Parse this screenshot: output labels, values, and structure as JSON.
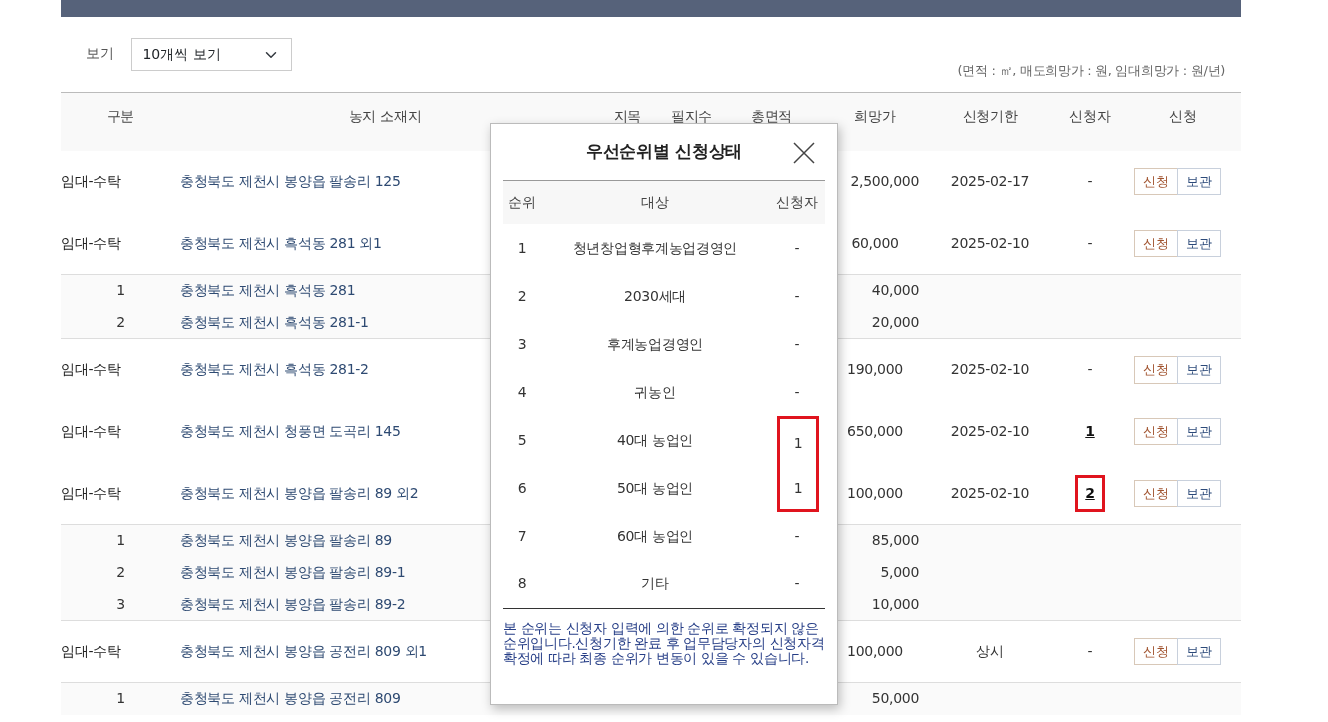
{
  "view_control": {
    "label": "보기",
    "value": "10개씩 보기"
  },
  "unit_note": "(면적 : ㎡, 매도희망가 : 원, 임대희망가 : 원/년)",
  "table": {
    "columns": [
      "구분",
      "농지 소재지",
      "지목",
      "필지수",
      "총면적",
      "희망가",
      "신청기한",
      "신청자",
      "신청"
    ],
    "rows": [
      {
        "type": "임대-수탁",
        "location": "충청북도 제천시 봉양읍 팔송리 125",
        "price": "2,500,000",
        "deadline": "2025-02-17",
        "applicants": "-",
        "applicants_link": false,
        "highlighted": false,
        "actions": [
          "신청",
          "보관"
        ],
        "parcels": []
      },
      {
        "type": "임대-수탁",
        "location": "충청북도 제천시 흑석동 281 외1",
        "price": "60,000",
        "deadline": "2025-02-10",
        "applicants": "-",
        "applicants_link": false,
        "highlighted": false,
        "actions": [
          "신청",
          "보관"
        ],
        "parcels": [
          {
            "index": "1",
            "location": "충청북도 제천시 흑석동 281",
            "price": "40,000"
          },
          {
            "index": "2",
            "location": "충청북도 제천시 흑석동 281-1",
            "price": "20,000"
          }
        ]
      },
      {
        "type": "임대-수탁",
        "location": "충청북도 제천시 흑석동 281-2",
        "price": "190,000",
        "deadline": "2025-02-10",
        "applicants": "-",
        "applicants_link": false,
        "highlighted": false,
        "actions": [
          "신청",
          "보관"
        ],
        "parcels": []
      },
      {
        "type": "임대-수탁",
        "location": "충청북도 제천시 청풍면 도곡리 145",
        "price": "650,000",
        "deadline": "2025-02-10",
        "applicants": "1",
        "applicants_link": true,
        "highlighted": false,
        "actions": [
          "신청",
          "보관"
        ],
        "parcels": []
      },
      {
        "type": "임대-수탁",
        "location": "충청북도 제천시 봉양읍 팔송리 89 외2",
        "price": "100,000",
        "deadline": "2025-02-10",
        "applicants": "2",
        "applicants_link": true,
        "highlighted": true,
        "actions": [
          "신청",
          "보관"
        ],
        "parcels": [
          {
            "index": "1",
            "location": "충청북도 제천시 봉양읍 팔송리 89",
            "price": "85,000"
          },
          {
            "index": "2",
            "location": "충청북도 제천시 봉양읍 팔송리 89-1",
            "price": "5,000"
          },
          {
            "index": "3",
            "location": "충청북도 제천시 봉양읍 팔송리 89-2",
            "price": "10,000"
          }
        ]
      },
      {
        "type": "임대-수탁",
        "location": "충청북도 제천시 봉양읍 공전리 809 외1",
        "price": "100,000",
        "deadline": "상시",
        "applicants": "-",
        "applicants_link": false,
        "highlighted": false,
        "actions": [
          "신청",
          "보관"
        ],
        "parcels": [
          {
            "index": "1",
            "location": "충청북도 제천시 봉양읍 공전리 809",
            "price": "50,000"
          }
        ]
      }
    ]
  },
  "modal": {
    "title": "우선순위별 신청상태",
    "columns": [
      "순위",
      "대상",
      "신청자"
    ],
    "rows": [
      {
        "rank": "1",
        "target": "청년창업형후계농업경영인",
        "applicants": "-",
        "highlighted": false
      },
      {
        "rank": "2",
        "target": "2030세대",
        "applicants": "-",
        "highlighted": false
      },
      {
        "rank": "3",
        "target": "후계농업경영인",
        "applicants": "-",
        "highlighted": false
      },
      {
        "rank": "4",
        "target": "귀농인",
        "applicants": "-",
        "highlighted": false
      },
      {
        "rank": "5",
        "target": "40대 농업인",
        "applicants": "1",
        "highlighted": true
      },
      {
        "rank": "6",
        "target": "50대 농업인",
        "applicants": "1",
        "highlighted": true
      },
      {
        "rank": "7",
        "target": "60대 농업인",
        "applicants": "-",
        "highlighted": false
      },
      {
        "rank": "8",
        "target": "기타",
        "applicants": "-",
        "highlighted": false
      }
    ],
    "note": "본 순위는 신청자 입력에 의한 순위로 확정되지 않은 순위입니다.신청기한 완료 후 업무담당자의 신청자격 확정에 따라 최종 순위가 변동이 있을 수 있습니다."
  }
}
